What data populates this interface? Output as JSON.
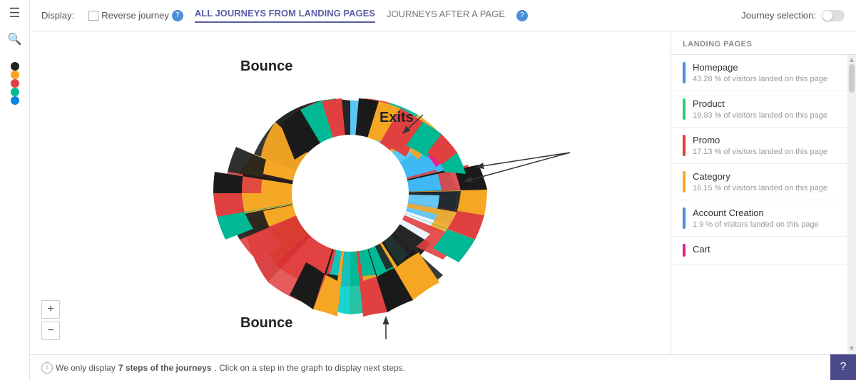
{
  "sidebar": {
    "dots": [
      {
        "color": "#222222",
        "label": "black-dot"
      },
      {
        "color": "#f5a623",
        "label": "orange-dot"
      },
      {
        "color": "#e04040",
        "label": "red-dot"
      },
      {
        "color": "#00b894",
        "label": "teal-dot"
      },
      {
        "color": "#0984e3",
        "label": "blue-dot"
      }
    ]
  },
  "toolbar": {
    "display_label": "Display:",
    "reverse_journey_label": "Reverse journey",
    "tab_all_journeys": "ALL JOURNEYS FROM LANDING PAGES",
    "tab_journeys_after": "JOURNEYS AFTER A PAGE",
    "journey_selection_label": "Journey selection:"
  },
  "landing_pages": {
    "header": "LANDING PAGES",
    "items": [
      {
        "name": "Homepage",
        "stat": "43.28 % of visitors landed on this page",
        "color": "#4a90d9"
      },
      {
        "name": "Product",
        "stat": "19.93 % of visitors landed on this page",
        "color": "#2ecc71"
      },
      {
        "name": "Promo",
        "stat": "17.13 % of visitors landed on this page",
        "color": "#e04040"
      },
      {
        "name": "Category",
        "stat": "16.15 % of visitors landed on this page",
        "color": "#f5a623"
      },
      {
        "name": "Account Creation",
        "stat": "1.9 % of visitors landed on this page",
        "color": "#4a90d9"
      },
      {
        "name": "Cart",
        "stat": "",
        "color": "#e91e8c"
      }
    ]
  },
  "chart_labels": {
    "bounce_top": "Bounce",
    "bounce_bottom": "Bounce",
    "exits": "Exits"
  },
  "bottom_bar": {
    "text_normal": "We only display ",
    "text_bold": "7 steps of the journeys",
    "text_rest": ". Click on a step in the graph to display next steps."
  },
  "zoom": {
    "plus": "+",
    "minus": "−"
  },
  "help": "?"
}
